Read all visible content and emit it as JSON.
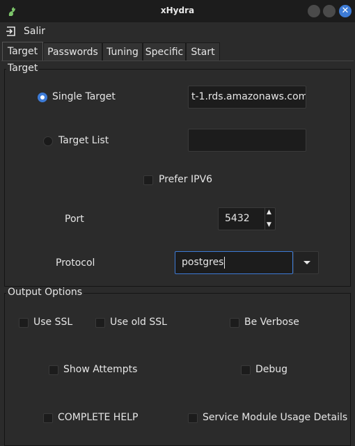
{
  "window": {
    "title": "xHydra"
  },
  "menu": {
    "exit_label": "Salir"
  },
  "tabs": [
    "Target",
    "Passwords",
    "Tuning",
    "Specific",
    "Start"
  ],
  "target_group": {
    "title": "Target",
    "single_target_label": "Single Target",
    "single_target_value": "t-1.rds.amazonaws.com",
    "target_list_label": "Target List",
    "target_list_value": "",
    "prefer_ipv6_label": "Prefer IPV6",
    "port_label": "Port",
    "port_value": "5432",
    "protocol_label": "Protocol",
    "protocol_value": "postgres"
  },
  "output_group": {
    "title": "Output Options",
    "use_ssl": "Use SSL",
    "use_old_ssl": "Use old SSL",
    "be_verbose": "Be Verbose",
    "show_attempts": "Show Attempts",
    "debug": "Debug",
    "complete_help": "COMPLETE HELP",
    "service_module_usage": "Service Module Usage Details"
  },
  "colors": {
    "accent": "#3d7bd6",
    "background": "#2b2b2b",
    "field": "#1c1c1c"
  }
}
